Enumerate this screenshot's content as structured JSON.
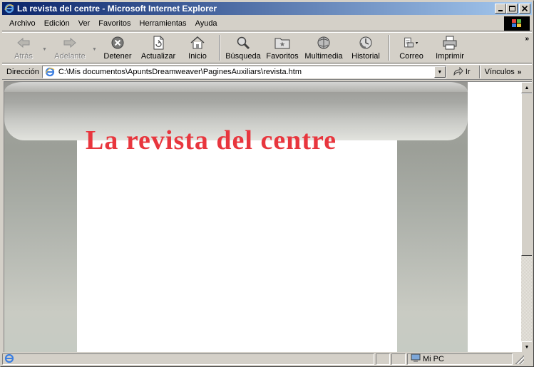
{
  "window": {
    "title": "La revista del centre - Microsoft Internet Explorer",
    "controls": {
      "minimize": "_",
      "maximize": "□",
      "close": "×"
    }
  },
  "menu": {
    "items": [
      "Archivo",
      "Edición",
      "Ver",
      "Favoritos",
      "Herramientas",
      "Ayuda"
    ]
  },
  "toolbar": {
    "buttons": [
      {
        "label": "Atrás",
        "icon": "back-arrow-icon",
        "enabled": false
      },
      {
        "label": "Adelante",
        "icon": "forward-arrow-icon",
        "enabled": false
      },
      {
        "label": "Detener",
        "icon": "stop-icon",
        "enabled": true
      },
      {
        "label": "Actualizar",
        "icon": "refresh-icon",
        "enabled": true
      },
      {
        "label": "Inicio",
        "icon": "home-icon",
        "enabled": true
      },
      {
        "label": "Búsqueda",
        "icon": "search-icon",
        "enabled": true
      },
      {
        "label": "Favoritos",
        "icon": "favorites-icon",
        "enabled": true
      },
      {
        "label": "Multimedia",
        "icon": "media-icon",
        "enabled": true
      },
      {
        "label": "Historial",
        "icon": "history-icon",
        "enabled": true
      },
      {
        "label": "Correo",
        "icon": "mail-icon",
        "enabled": true
      },
      {
        "label": "Imprimir",
        "icon": "print-icon",
        "enabled": true
      }
    ],
    "overflow": "»"
  },
  "address": {
    "label": "Dirección",
    "value": "C:\\Mis documentos\\ApuntsDreamweaver\\PaginesAuxiliars\\revista.htm",
    "go_label": "Ir",
    "links_label": "Vínculos",
    "links_overflow": "»"
  },
  "page": {
    "heading": "La revista del centre",
    "heading_color": "#e8363e"
  },
  "status": {
    "text": "",
    "zone": "Mi PC"
  }
}
